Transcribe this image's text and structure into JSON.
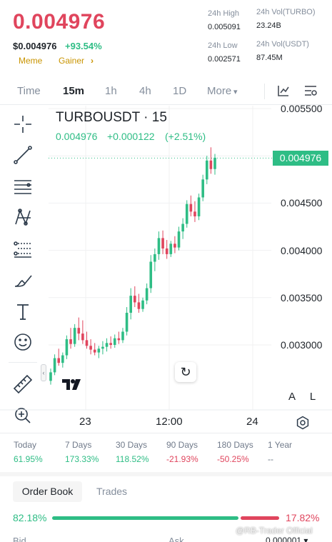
{
  "header": {
    "price": "0.004976",
    "price_usd": "$0.004976",
    "change_pct": "+93.54%",
    "tags": [
      "Meme",
      "Gainer"
    ],
    "tag_arrow": "›",
    "stats": {
      "high_label": "24h High",
      "high_value": "0.005091",
      "low_label": "24h Low",
      "low_value": "0.002571",
      "vol_base_label": "24h Vol(TURBO)",
      "vol_base_value": "23.24B",
      "vol_quote_label": "24h Vol(USDT)",
      "vol_quote_value": "87.45M"
    }
  },
  "intervals": {
    "items": [
      "Time",
      "15m",
      "1h",
      "4h",
      "1D",
      "More"
    ],
    "active": "15m",
    "more_arrow": "▾"
  },
  "tools": [
    "crosshair-icon",
    "trend-line-icon",
    "horizontal-lines-icon",
    "pattern-icon",
    "fib-retracement-icon",
    "brush-icon",
    "text-tool-icon",
    "emoji-icon",
    "ruler-icon",
    "zoom-in-icon"
  ],
  "chart": {
    "title": "TURBOUSDT · 15",
    "last_price": "0.004976",
    "change_abs": "+0.000122",
    "change_pct": "(+2.51%)",
    "price_tag": "0.004976",
    "y_ticks": [
      "0.005500",
      "0.005000",
      "0.004500",
      "0.004000",
      "0.003500",
      "0.003000"
    ],
    "x_ticks": [
      "23",
      "12:00",
      "24"
    ],
    "logo": "TV",
    "scale_buttons": [
      "A",
      "L"
    ]
  },
  "chart_data": {
    "type": "candlestick",
    "title": "TURBOUSDT · 15",
    "ylim": [
      0.00255,
      0.0056
    ],
    "y_ticks": [
      0.0055,
      0.005,
      0.0045,
      0.004,
      0.0035,
      0.003
    ],
    "x_ticks": [
      "23",
      "12:00",
      "24"
    ],
    "last_price": 0.004976,
    "ohlc": [
      [
        0.00262,
        0.00275,
        0.00258,
        0.00271
      ],
      [
        0.00271,
        0.0029,
        0.00268,
        0.00286
      ],
      [
        0.00286,
        0.00296,
        0.00278,
        0.00281
      ],
      [
        0.00281,
        0.00292,
        0.00276,
        0.00289
      ],
      [
        0.00289,
        0.0031,
        0.00285,
        0.00306
      ],
      [
        0.00306,
        0.00318,
        0.00296,
        0.00301
      ],
      [
        0.00301,
        0.00322,
        0.00298,
        0.00318
      ],
      [
        0.00318,
        0.00329,
        0.00305,
        0.00312
      ],
      [
        0.00312,
        0.00326,
        0.00301,
        0.00305
      ],
      [
        0.00305,
        0.00314,
        0.00296,
        0.00299
      ],
      [
        0.00299,
        0.00306,
        0.0029,
        0.00295
      ],
      [
        0.00295,
        0.00302,
        0.00289,
        0.00292
      ],
      [
        0.00292,
        0.00299,
        0.00286,
        0.00296
      ],
      [
        0.00296,
        0.00304,
        0.0029,
        0.00298
      ],
      [
        0.00298,
        0.00307,
        0.00293,
        0.00302
      ],
      [
        0.00302,
        0.00309,
        0.00296,
        0.003
      ],
      [
        0.003,
        0.00311,
        0.00297,
        0.00307
      ],
      [
        0.00307,
        0.00314,
        0.00301,
        0.00305
      ],
      [
        0.00305,
        0.00318,
        0.00302,
        0.00314
      ],
      [
        0.00314,
        0.0034,
        0.0031,
        0.00334
      ],
      [
        0.00334,
        0.0036,
        0.00327,
        0.00352
      ],
      [
        0.00352,
        0.00362,
        0.0034,
        0.00345
      ],
      [
        0.00345,
        0.00354,
        0.00334,
        0.00338
      ],
      [
        0.00338,
        0.0035,
        0.00335,
        0.00347
      ],
      [
        0.00347,
        0.00365,
        0.00343,
        0.0036
      ],
      [
        0.0036,
        0.00395,
        0.00355,
        0.00388
      ],
      [
        0.00388,
        0.00402,
        0.00378,
        0.00396
      ],
      [
        0.00396,
        0.0042,
        0.0039,
        0.00413
      ],
      [
        0.00413,
        0.00421,
        0.00396,
        0.00402
      ],
      [
        0.00402,
        0.00411,
        0.00391,
        0.00396
      ],
      [
        0.00396,
        0.0041,
        0.00393,
        0.00407
      ],
      [
        0.00407,
        0.00415,
        0.00397,
        0.00403
      ],
      [
        0.00403,
        0.00425,
        0.004,
        0.0042
      ],
      [
        0.0042,
        0.00434,
        0.00412,
        0.00428
      ],
      [
        0.00428,
        0.00453,
        0.00424,
        0.00449
      ],
      [
        0.00449,
        0.00458,
        0.00436,
        0.00441
      ],
      [
        0.00441,
        0.00452,
        0.0043,
        0.00436
      ],
      [
        0.00436,
        0.0046,
        0.00432,
        0.00456
      ],
      [
        0.00456,
        0.0048,
        0.00452,
        0.00475
      ],
      [
        0.00475,
        0.005,
        0.0047,
        0.00495
      ],
      [
        0.00495,
        0.00509,
        0.00481,
        0.00486
      ],
      [
        0.00486,
        0.00502,
        0.0048,
        0.00498
      ]
    ]
  },
  "periods": [
    {
      "label": "Today",
      "value": "61.95%",
      "dir": "up"
    },
    {
      "label": "7 Days",
      "value": "173.33%",
      "dir": "up"
    },
    {
      "label": "30 Days",
      "value": "118.52%",
      "dir": "up"
    },
    {
      "label": "90 Days",
      "value": "-21.93%",
      "dir": "down"
    },
    {
      "label": "180 Days",
      "value": "-50.25%",
      "dir": "down"
    },
    {
      "label": "1 Year",
      "value": "--",
      "dir": "none"
    }
  ],
  "orderbook": {
    "tabs": [
      "Order Book",
      "Trades"
    ],
    "buy_pct": "82.18%",
    "sell_pct": "17.82%",
    "buy_ratio": 0.8218,
    "bid_label": "Bid",
    "ask_label": "Ask",
    "step": "0.000001 ▾"
  },
  "watermark": "@RB-Trader Official",
  "colors": {
    "up": "#2ebd85",
    "down": "#e0455d",
    "accent": "#c99400"
  }
}
